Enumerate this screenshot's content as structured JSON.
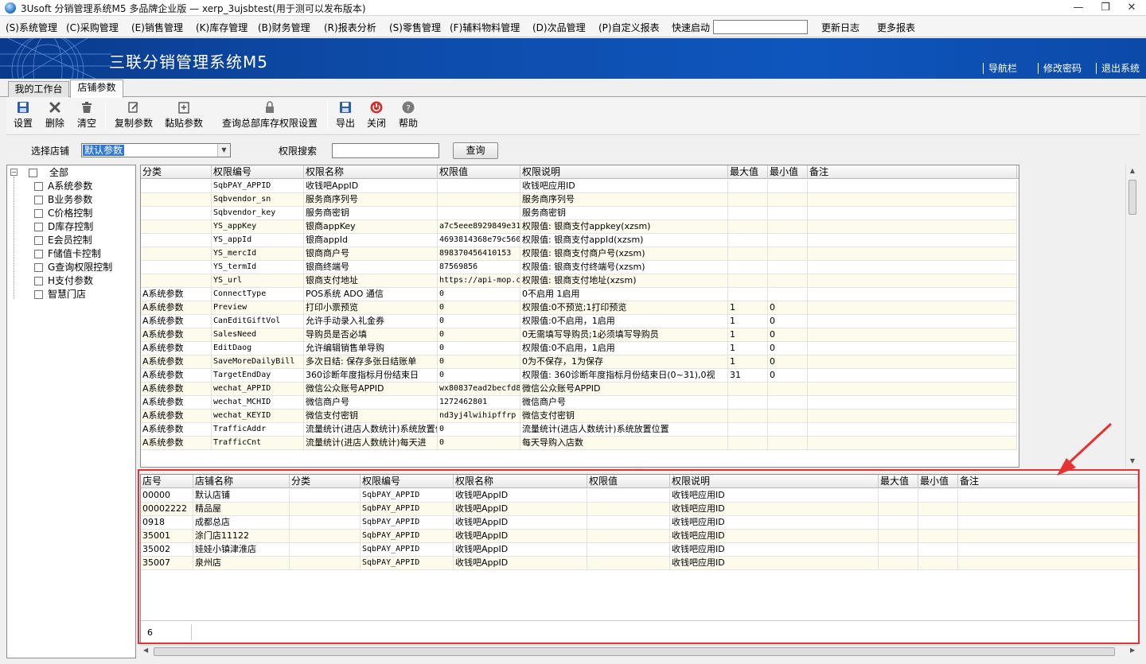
{
  "window": {
    "title": "3Usoft 分销管理系统M5 多品牌企业版 — xerp_3ujsbtest(用于测可以发布版本)",
    "min": "—",
    "max": "❐",
    "close": "✕"
  },
  "menu": {
    "items": [
      "(S)系统管理",
      "(C)采购管理",
      "(E)销售管理",
      "(K)库存管理",
      "(B)财务管理",
      "(R)报表分析",
      "(S)零售管理",
      "(F)辅料物料管理",
      "(D)次品管理",
      "(P)自定义报表"
    ],
    "quick_start": "快速启动",
    "quick_value": "",
    "changelog": "更新日志",
    "more_reports": "更多报表"
  },
  "banner": {
    "title": "三联分销管理系统M5",
    "nav": "导航栏",
    "change_pwd": "修改密码",
    "logout": "退出系统"
  },
  "tabs": [
    {
      "label": "我的工作台",
      "active": false
    },
    {
      "label": "店铺参数",
      "active": true
    }
  ],
  "toolbar": {
    "settings": "设置",
    "delete": "删除",
    "clear": "清空",
    "copy_params": "复制参数",
    "paste_params": "黏贴参数",
    "query_hq": "查询总部库存权限设置",
    "export": "导出",
    "close": "关闭",
    "help": "帮助"
  },
  "filter": {
    "store_label": "选择店铺",
    "store_value": "默认参数",
    "perm_label": "权限搜索",
    "perm_value": "",
    "query_btn": "查询"
  },
  "tree": {
    "root": "全部",
    "items": [
      "A系统参数",
      "B业务参数",
      "C价格控制",
      "D库存控制",
      "E会员控制",
      "F储值卡控制",
      "G查询权限控制",
      "H支付参数",
      "智慧门店"
    ]
  },
  "grid1": {
    "columns": [
      "分类",
      "权限编号",
      "权限名称",
      "权限值",
      "权限说明",
      "最大值",
      "最小值",
      "备注"
    ],
    "rows": [
      [
        "",
        "SqbPAY_APPID",
        "收钱吧AppID",
        "",
        "收钱吧应用ID",
        "",
        "",
        ""
      ],
      [
        "",
        "Sqbvendor_sn",
        "服务商序列号",
        "",
        "服务商序列号",
        "",
        "",
        ""
      ],
      [
        "",
        "Sqbvendor_key",
        "服务商密钥",
        "",
        "服务商密钥",
        "",
        "",
        ""
      ],
      [
        "",
        "YS_appKey",
        "银商appKey",
        "a7c5eee8929849e31",
        "权限值: 银商支付appkey(xzsm)",
        "",
        "",
        ""
      ],
      [
        "",
        "YS_appId",
        "银商appId",
        "4693814368e79c560",
        "权限值: 银商支付appId(xzsm)",
        "",
        "",
        ""
      ],
      [
        "",
        "YS_mercId",
        "银商商户号",
        "898370456410153",
        "权限值: 银商支付商户号(xzsm)",
        "",
        "",
        ""
      ],
      [
        "",
        "YS_termId",
        "银商终端号",
        "87569856",
        "权限值: 银商支付终端号(xzsm)",
        "",
        "",
        ""
      ],
      [
        "",
        "YS_url",
        "银商支付地址",
        "https://api-mop.c",
        "权限值: 银商支付地址(xzsm)",
        "",
        "",
        ""
      ],
      [
        "A系统参数",
        "ConnectType",
        "POS系统 ADO 通信",
        "0",
        "0不启用 1启用",
        "",
        "",
        ""
      ],
      [
        "A系统参数",
        "Preview",
        "打印小票预览",
        "0",
        "权限值:0不预览;1打印预览",
        "1",
        "0",
        ""
      ],
      [
        "A系统参数",
        "CanEditGiftVol",
        "允许手动录入礼金券",
        "0",
        "权限值:0不启用，1启用",
        "1",
        "0",
        ""
      ],
      [
        "A系统参数",
        "SalesNeed",
        "导购员是否必填",
        "0",
        "0无需填写导购员;1必须填写导购员",
        "1",
        "0",
        ""
      ],
      [
        "A系统参数",
        "EditDaog",
        "允许编辑销售单导购",
        "0",
        "权限值:0不启用，1启用",
        "1",
        "0",
        ""
      ],
      [
        "A系统参数",
        "SaveMoreDailyBill",
        "多次日结: 保存多张日结账单",
        "0",
        "0为不保存，1为保存",
        "1",
        "0",
        ""
      ],
      [
        "A系统参数",
        "TargetEndDay",
        "360诊断年度指标月份结束日",
        "0",
        "权限值: 360诊断年度指标月份结束日(0~31),0视",
        "31",
        "0",
        ""
      ],
      [
        "A系统参数",
        "wechat_APPID",
        "微信公众账号APPID",
        "wx80837ead2becfd8",
        "微信公众账号APPID",
        "",
        "",
        ""
      ],
      [
        "A系统参数",
        "wechat_MCHID",
        "微信商户号",
        "1272462801",
        "微信商户号",
        "",
        "",
        ""
      ],
      [
        "A系统参数",
        "wechat_KEYID",
        "微信支付密钥",
        "nd3yj4lwihipffrp",
        "微信支付密钥",
        "",
        "",
        ""
      ],
      [
        "A系统参数",
        "TrafficAddr",
        "流量统计(进店人数统计)系统放置位置",
        "0",
        "流量统计(进店人数统计)系统放置位置",
        "",
        "",
        ""
      ],
      [
        "A系统参数",
        "TrafficCnt",
        "流量统计(进店人数统计)每天进",
        "0",
        "每天导购入店数",
        "",
        "",
        ""
      ]
    ]
  },
  "grid2": {
    "columns": [
      "店号",
      "店铺名称",
      "分类",
      "权限编号",
      "权限名称",
      "权限值",
      "权限说明",
      "最大值",
      "最小值",
      "备注"
    ],
    "rows": [
      [
        "00000",
        "默认店铺",
        "",
        "SqbPAY_APPID",
        "收钱吧AppID",
        "",
        "收钱吧应用ID",
        "",
        "",
        ""
      ],
      [
        "00002222",
        "精品屋",
        "",
        "SqbPAY_APPID",
        "收钱吧AppID",
        "",
        "收钱吧应用ID",
        "",
        "",
        ""
      ],
      [
        "0918",
        "成都总店",
        "",
        "SqbPAY_APPID",
        "收钱吧AppID",
        "",
        "收钱吧应用ID",
        "",
        "",
        ""
      ],
      [
        "35001",
        "涂门店11122",
        "",
        "SqbPAY_APPID",
        "收钱吧AppID",
        "",
        "收钱吧应用ID",
        "",
        "",
        ""
      ],
      [
        "35002",
        "娃娃小镇津淮店",
        "",
        "SqbPAY_APPID",
        "收钱吧AppID",
        "",
        "收钱吧应用ID",
        "",
        "",
        ""
      ],
      [
        "35007",
        "泉州店",
        "",
        "SqbPAY_APPID",
        "收钱吧AppID",
        "",
        "收钱吧应用ID",
        "",
        "",
        ""
      ]
    ],
    "count": "6"
  },
  "colors": {
    "banner": "#0d4aa6",
    "alt_row": "#fdfbec",
    "highlight": "#e53333",
    "select": "#3178d0"
  }
}
